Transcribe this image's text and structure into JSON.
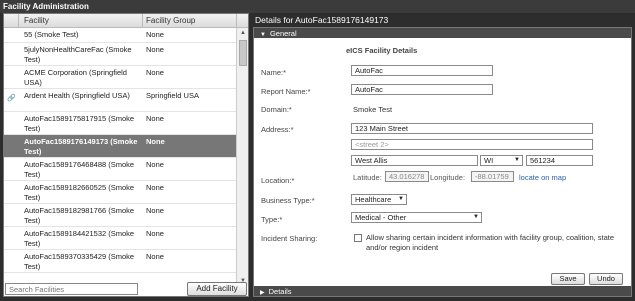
{
  "header": {
    "title": "Facility Administration"
  },
  "list": {
    "columns": {
      "facility": "Facility",
      "group": "Facility Group"
    },
    "rows": [
      {
        "name": "55 (Smoke Test)",
        "group": "None",
        "linked": false,
        "selected": false
      },
      {
        "name": "5julyNonHealthCareFac (Smoke Test)",
        "group": "None",
        "linked": false,
        "selected": false
      },
      {
        "name": "ACME Corporation (Springfield USA)",
        "group": "None",
        "linked": false,
        "selected": false
      },
      {
        "name": "Ardent Health (Springfield USA)",
        "group": "Springfield USA",
        "linked": true,
        "selected": false
      },
      {
        "name": "AutoFac1589175817915 (Smoke Test)",
        "group": "None",
        "linked": false,
        "selected": false
      },
      {
        "name": "AutoFac1589176149173 (Smoke Test)",
        "group": "None",
        "linked": false,
        "selected": true
      },
      {
        "name": "AutoFac1589176468488 (Smoke Test)",
        "group": "None",
        "linked": false,
        "selected": false
      },
      {
        "name": "AutoFac1589182660525 (Smoke Test)",
        "group": "None",
        "linked": false,
        "selected": false
      },
      {
        "name": "AutoFac1589182981766 (Smoke Test)",
        "group": "None",
        "linked": false,
        "selected": false
      },
      {
        "name": "AutoFac1589184421532 (Smoke Test)",
        "group": "None",
        "linked": false,
        "selected": false
      },
      {
        "name": "AutoFac1589370335429 (Smoke Test)",
        "group": "None",
        "linked": false,
        "selected": false
      }
    ],
    "search_placeholder": "Search Facilities",
    "add_button": "Add Facility"
  },
  "details": {
    "title": "Details for AutoFac1589176149173",
    "general_label": "General",
    "details_label": "Details",
    "section_title": "eICS Facility Details",
    "name_label": "Name:*",
    "name_value": "AutoFac",
    "report_name_label": "Report Name:*",
    "report_name_value": "AutoFac",
    "domain_label": "Domain:*",
    "domain_value": "Smoke Test",
    "address_label": "Address:*",
    "street1": "123 Main Street",
    "street2_placeholder": "<street 2>",
    "city": "West Allis",
    "state": "WI",
    "zip": "561234",
    "location_label": "Location:*",
    "latitude_label": "Latitude:",
    "latitude_value": "43.016278",
    "longitude_label": "Longitude:",
    "longitude_value": "-88.01759",
    "locate_link": "locate on map",
    "business_type_label": "Business Type:*",
    "business_type_value": "Healthcare",
    "type_label": "Type:*",
    "type_value": "Medical - Other",
    "incident_sharing_label": "Incident Sharing:",
    "incident_sharing_text": "Allow sharing certain incident information with facility group, coalition, state and/or region incident",
    "save_label": "Save",
    "undo_label": "Undo"
  }
}
